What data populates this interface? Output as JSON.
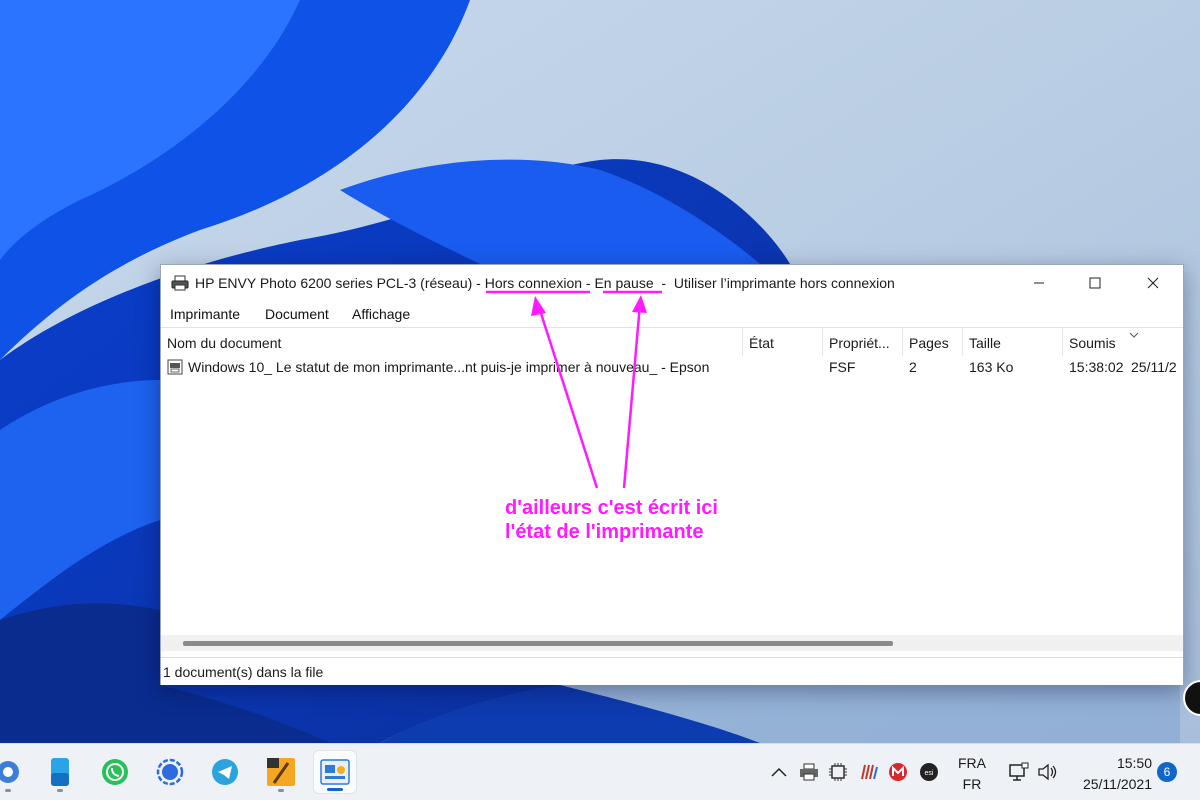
{
  "window": {
    "title_parts": [
      "HP ENVY Photo 6200 series PCL-3 (réseau) - ",
      "Hors connexion",
      " - ",
      "En pause",
      "  -  Utiliser l’imprimante hors connexion"
    ],
    "controls": [
      "minimize",
      "maximize",
      "close"
    ]
  },
  "menu": [
    "Imprimante",
    "Document",
    "Affichage"
  ],
  "columns": [
    "Nom du document",
    "État",
    "Propriét...",
    "Pages",
    "Taille",
    "Soumis"
  ],
  "rows": [
    {
      "name": "Windows 10_ Le statut de mon imprimante...nt puis-je imprimer à nouveau_ - Epson",
      "state": "",
      "owner": "FSF",
      "pages": "2",
      "size": "163 Ko",
      "time": "15:38:02",
      "date": "25/11/2"
    }
  ],
  "status": "1 document(s) dans la file",
  "annotation": {
    "lines": [
      "d'ailleurs c'est écrit ici",
      "l'état de l'imprimante"
    ],
    "color": "#ff1aff"
  },
  "taskbar": {
    "apps": [
      "browser-icon",
      "files-icon",
      "whatsapp-icon",
      "signal-icon",
      "telegram-icon",
      "app-64-icon",
      "printer-queue-icon"
    ],
    "tray": {
      "lang_top": "FRA",
      "lang_bottom": "FR",
      "time": "15:50",
      "date": "25/11/2021",
      "notifications": "6"
    }
  },
  "colors": {
    "accent": "#1167c8",
    "annotation": "#ff1aff"
  }
}
